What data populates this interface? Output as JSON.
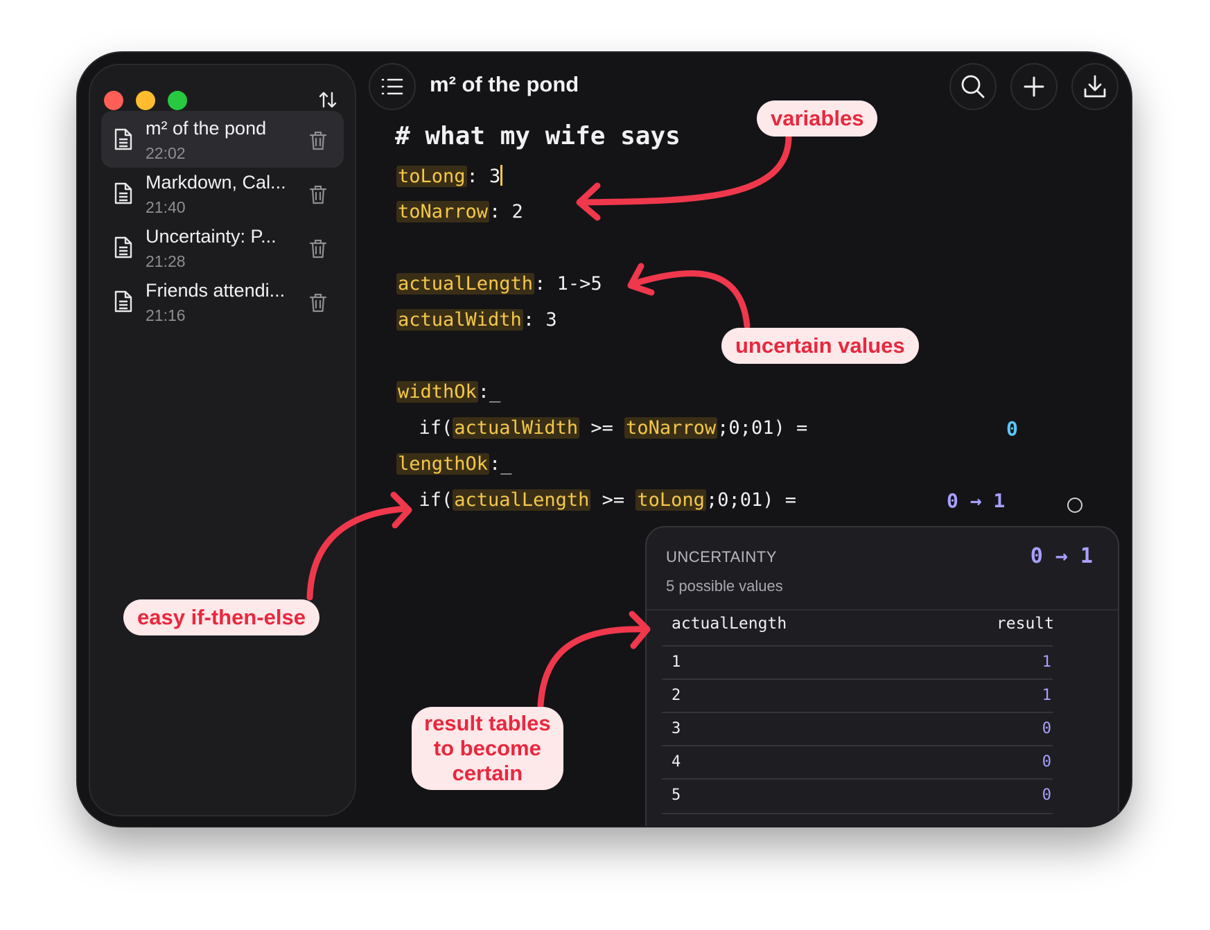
{
  "window_controls": [
    "close",
    "minimize",
    "zoom"
  ],
  "sidebar": {
    "sort_icon": "sort-arrows-icon",
    "notes": [
      {
        "title": "m² of the pond",
        "time": "22:02",
        "active": true
      },
      {
        "title": "Markdown, Cal...",
        "time": "21:40",
        "active": false
      },
      {
        "title": "Uncertainty: P...",
        "time": "21:28",
        "active": false
      },
      {
        "title": "Friends attendi...",
        "time": "21:16",
        "active": false
      }
    ]
  },
  "toolbar": {
    "menu_icon": "list-icon",
    "title": "m² of the pond",
    "search_icon": "search-icon",
    "add_icon": "plus-icon",
    "export_icon": "download-icon"
  },
  "editor": {
    "heading": "# what my wife says",
    "lines": {
      "toLong_name": "toLong",
      "toLong_value": ": 3",
      "toNarrow_name": "toNarrow",
      "toNarrow_value": ": 2",
      "actualLength_name": "actualLength",
      "actualLength_value": ": 1->5",
      "actualWidth_name": "actualWidth",
      "actualWidth_value": ": 3",
      "widthOk_name": "widthOk",
      "widthOk_suffix": ":_",
      "if1_prefix": "  if(",
      "if1_var1": "actualWidth",
      "if1_op": " >= ",
      "if1_var2": "toNarrow",
      "if1_suffix": ";0;01) =",
      "lengthOk_name": "lengthOk",
      "lengthOk_suffix": ":_",
      "if2_prefix": "  if(",
      "if2_var1": "actualLength",
      "if2_op": " >= ",
      "if2_var2": "toLong",
      "if2_suffix": ";0;01) ="
    },
    "result_widthOk": "0",
    "result_lengthOk": "0 → 1"
  },
  "popover": {
    "heading": "UNCERTAINTY",
    "subtitle": "5 possible values",
    "range": "0 → 1",
    "columns": [
      "actualLength",
      "result"
    ],
    "rows": [
      [
        "1",
        "1"
      ],
      [
        "2",
        "1"
      ],
      [
        "3",
        "0"
      ],
      [
        "4",
        "0"
      ],
      [
        "5",
        "0"
      ]
    ]
  },
  "annotations": {
    "variables": "variables",
    "uncertain": "uncertain values",
    "ifelse": "easy if-then-else",
    "tables": [
      "result tables",
      "to become",
      "certain"
    ]
  },
  "colors": {
    "variable_text": "#f5c84c",
    "variable_bg": "#3a2f16",
    "result_cyan": "#5ac8fa",
    "result_violet": "#a8a0ff",
    "annotation_red": "#e8283e",
    "annotation_bg": "#fde8ea"
  }
}
